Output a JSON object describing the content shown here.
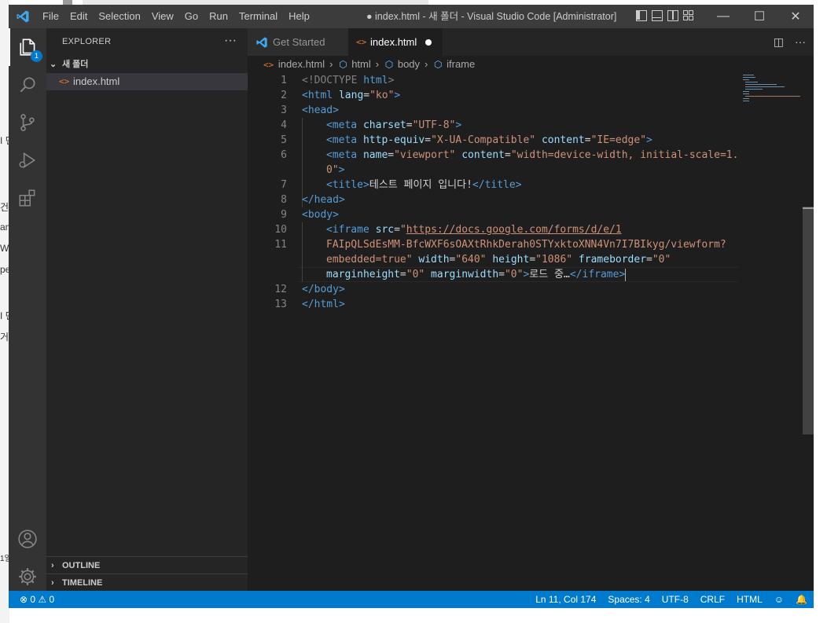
{
  "background_fragments": [
    "I 던",
    "건",
    "am",
    "W",
    "pe",
    "I 던",
    "거",
    "1일"
  ],
  "titlebar": {
    "menu": [
      "File",
      "Edit",
      "Selection",
      "View",
      "Go",
      "Run",
      "Terminal",
      "Help"
    ],
    "title": "● index.html - 새 폴더 - Visual Studio Code [Administrator]",
    "minimize": "—",
    "maximize": "☐",
    "close": "✕"
  },
  "activity": {
    "explorer_badge": "1"
  },
  "sidebar": {
    "title": "EXPLORER",
    "more": "···",
    "folder": "새 폴더",
    "file_icon": "<>",
    "file": "index.html",
    "outline": "OUTLINE",
    "timeline": "TIMELINE"
  },
  "tabs": {
    "tab1": "Get Started",
    "tab2_icon": "<>",
    "tab2": "index.html",
    "split": "◫",
    "more": "···"
  },
  "breadcrumbs": [
    "index.html",
    "html",
    "body",
    "iframe"
  ],
  "code": {
    "line_numbers": [
      "1",
      "2",
      "3",
      "4",
      "5",
      "6",
      "",
      "7",
      "8",
      "9",
      "10",
      "11",
      "",
      "",
      "12",
      "13"
    ],
    "l1": [
      "<!DOCTYPE",
      " html",
      ">"
    ],
    "l2": [
      "<html",
      " lang",
      "=",
      "\"ko\"",
      ">"
    ],
    "l3": [
      "<head>"
    ],
    "l4": [
      "<meta",
      " charset",
      "=",
      "\"UTF-8\"",
      ">"
    ],
    "l5": [
      "<meta",
      " http-equiv",
      "=",
      "\"X-UA-Compatible\"",
      " content",
      "=",
      "\"IE=edge\"",
      ">"
    ],
    "l6": [
      "<meta",
      " name",
      "=",
      "\"viewport\"",
      " content",
      "=",
      "\"width=device-width, initial-scale=1."
    ],
    "l6b": [
      "0\"",
      ">"
    ],
    "l7": [
      "<title>",
      "테스트 페이지 입니다!",
      "</title>"
    ],
    "l8": [
      "</head>"
    ],
    "l9": [
      "<body>"
    ],
    "l10": [
      "<iframe",
      " src",
      "=",
      "\"",
      "https://docs.google.com/forms/d/e/1"
    ],
    "l11a": [
      "FAIpQLSdEsMM-BfcWXF6sOAXtRhkDerah0STYxktoXNN4Vn7I7BIkyg/viewform?"
    ],
    "l11b": [
      "embedded=true\"",
      " width",
      "=",
      "\"640\"",
      " height",
      "=",
      "\"1086\"",
      " frameborder",
      "=",
      "\"0\""
    ],
    "l11c": [
      "marginheight",
      "=",
      "\"0\"",
      " marginwidth",
      "=",
      "\"0\"",
      ">",
      "로드 중…",
      "</iframe>"
    ],
    "l12": [
      "</body>"
    ],
    "l13": [
      "</html>"
    ]
  },
  "status": {
    "problems": "⊗ 0 ⚠ 0",
    "position": "Ln 11, Col 174",
    "spaces": "Spaces: 4",
    "encoding": "UTF-8",
    "eol": "CRLF",
    "language": "HTML",
    "feedback_icon": "☺",
    "bell_icon": "🔔"
  },
  "colors": {
    "accent": "#007acc",
    "titlebar": "#3c3c3c",
    "activity": "#333333",
    "sidebar": "#252526",
    "editor": "#1e1e1e",
    "tag": "#569cd6",
    "attr": "#9cdcfe",
    "string": "#ce9178"
  }
}
